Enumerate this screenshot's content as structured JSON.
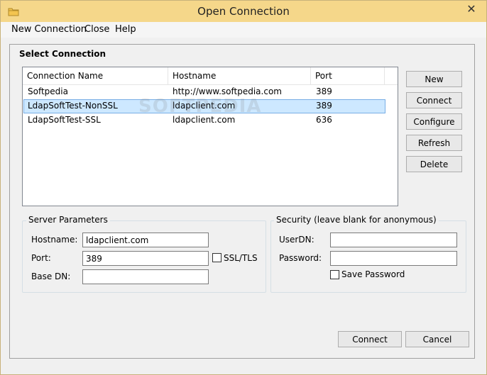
{
  "window": {
    "title": "Open Connection"
  },
  "menu": {
    "items": [
      "New Connection",
      "Close",
      "Help"
    ]
  },
  "select_connection": {
    "title": "Select Connection",
    "columns": [
      "Connection Name",
      "Hostname",
      "Port"
    ],
    "rows": [
      {
        "name": "Softpedia",
        "hostname": "http://www.softpedia.com",
        "port": "389"
      },
      {
        "name": "LdapSoftTest-NonSSL",
        "hostname": "ldapclient.com",
        "port": "389"
      },
      {
        "name": "LdapSoftTest-SSL",
        "hostname": "ldapclient.com",
        "port": "636"
      }
    ],
    "selected_index": 1
  },
  "side_buttons": [
    "New",
    "Connect",
    "Configure",
    "Refresh",
    "Delete"
  ],
  "watermark": "SOFTPEDIA",
  "server_params": {
    "title": "Server Parameters",
    "hostname_label": "Hostname:",
    "hostname_value": "ldapclient.com",
    "port_label": "Port:",
    "port_value": "389",
    "ssl_label": "SSL/TLS",
    "basedn_label": "Base DN:",
    "basedn_value": ""
  },
  "security": {
    "title": "Security (leave blank for anonymous)",
    "userdn_label": "UserDN:",
    "userdn_value": "",
    "password_label": "Password:",
    "password_value": "",
    "save_password_label": "Save Password"
  },
  "bottom_buttons": {
    "connect": "Connect",
    "cancel": "Cancel"
  }
}
